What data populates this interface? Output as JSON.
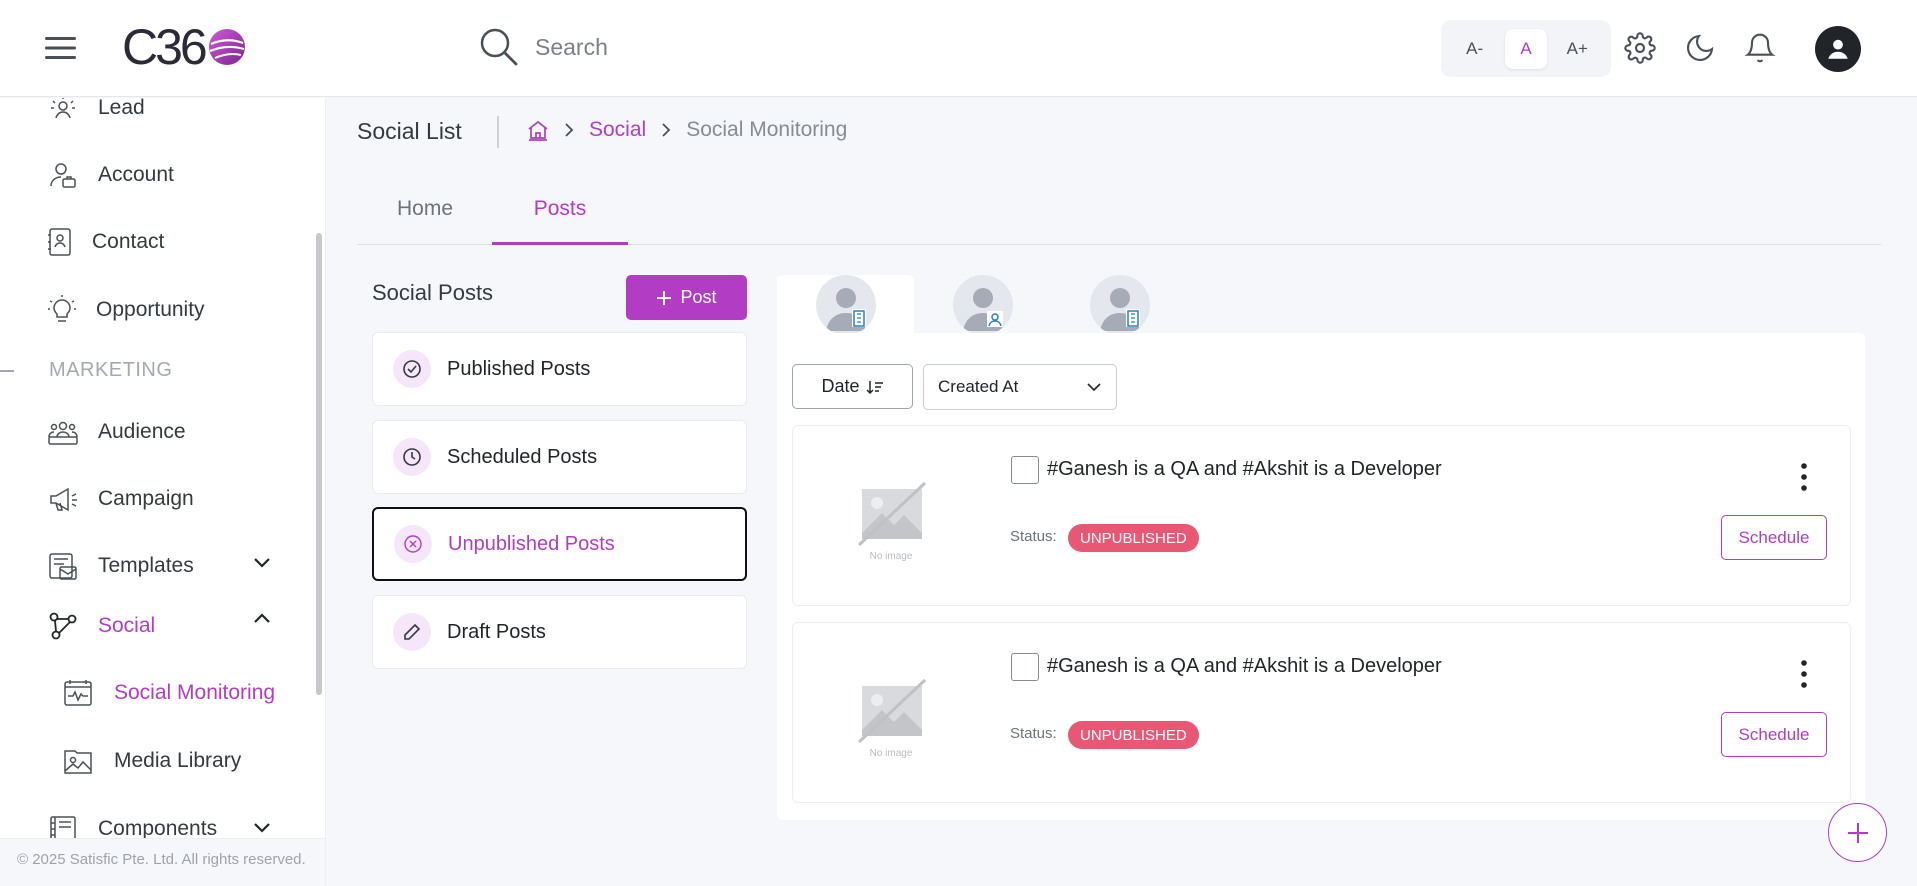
{
  "header": {
    "logo_text": "C36",
    "search_placeholder": "Search",
    "font_size_controls": [
      {
        "label": "A-",
        "active": false
      },
      {
        "label": "A",
        "active": true
      },
      {
        "label": "A+",
        "active": false
      }
    ],
    "icons": [
      "menu-icon",
      "search-icon",
      "gear-icon",
      "moon-icon",
      "bell-icon",
      "user-avatar-icon"
    ]
  },
  "sidebar": {
    "items_top": [
      {
        "label": "Lead",
        "icon": "lead-icon"
      },
      {
        "label": "Account",
        "icon": "account-icon"
      },
      {
        "label": "Contact",
        "icon": "contact-icon"
      },
      {
        "label": "Opportunity",
        "icon": "lightbulb-icon"
      }
    ],
    "section_label": "MARKETING",
    "items_marketing": [
      {
        "label": "Audience",
        "icon": "audience-icon"
      },
      {
        "label": "Campaign",
        "icon": "megaphone-icon"
      },
      {
        "label": "Templates",
        "icon": "templates-icon",
        "expanded": false
      },
      {
        "label": "Social",
        "icon": "social-icon",
        "expanded": true,
        "active": true
      }
    ],
    "sub_items": [
      {
        "label": "Social Monitoring",
        "icon": "monitoring-icon",
        "active": true
      },
      {
        "label": "Media Library",
        "icon": "media-library-icon"
      }
    ],
    "item_components": {
      "label": "Components",
      "icon": "components-icon",
      "expanded": false
    },
    "footer": "© 2025 Satisfic Pte. Ltd. All rights reserved."
  },
  "page": {
    "title": "Social List",
    "breadcrumb": {
      "link": "Social",
      "current": "Social Monitoring"
    },
    "tabs": [
      {
        "label": "Home",
        "active": false
      },
      {
        "label": "Posts",
        "active": true
      }
    ]
  },
  "social_posts": {
    "title": "Social Posts",
    "add_button": "Post",
    "categories": [
      {
        "label": "Published Posts",
        "icon": "check-circle-icon",
        "active": false
      },
      {
        "label": "Scheduled Posts",
        "icon": "clock-icon",
        "active": false
      },
      {
        "label": "Unpublished Posts",
        "icon": "x-circle-icon",
        "active": true
      },
      {
        "label": "Draft Posts",
        "icon": "pencil-icon",
        "active": false
      }
    ]
  },
  "accounts": [
    {
      "icon": "business-account-icon",
      "active": true
    },
    {
      "icon": "personal-account-icon",
      "active": false
    },
    {
      "icon": "business-account-icon",
      "active": false
    }
  ],
  "sort": {
    "button_label": "Date",
    "select_value": "Created At"
  },
  "posts": [
    {
      "text": "#Ganesh is a QA and #Akshit is a Developer",
      "status_label": "Status:",
      "status": "UNPUBLISHED",
      "image_placeholder": "No image",
      "action": "Schedule"
    },
    {
      "text": "#Ganesh is a QA and #Akshit is a Developer",
      "status_label": "Status:",
      "status": "UNPUBLISHED",
      "image_placeholder": "No image",
      "action": "Schedule"
    }
  ],
  "colors": {
    "accent": "#b23cc4",
    "status_unpublished": "#e85874"
  }
}
